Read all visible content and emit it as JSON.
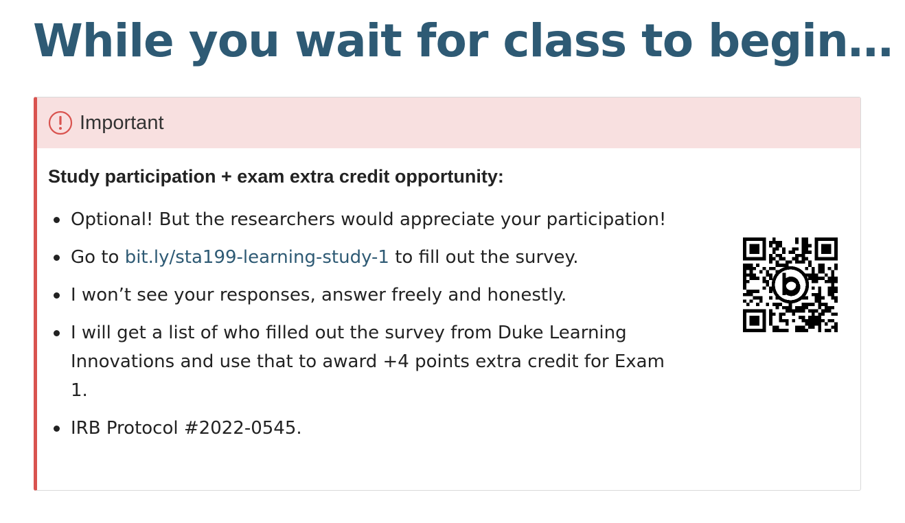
{
  "title": "While you wait for class to begin…",
  "callout": {
    "label": "Important",
    "heading": "Study participation + exam extra credit opportunity:",
    "bullets": {
      "b1": "Optional! But the researchers would appreciate your participation!",
      "b2_prefix": "Go to ",
      "b2_link": "bit.ly/sta199-learning-study-1",
      "b2_suffix": " to fill out the survey.",
      "b3": "I won’t see your responses, answer freely and honestly.",
      "b4": "I will get a list of who filled out the survey from Duke Learning Innovations and use that to award +4 points extra credit for Exam 1.",
      "b5": "IRB Protocol #2022-0545."
    }
  },
  "colors": {
    "title": "#2e5a74",
    "accent_border": "#d9534f",
    "header_bg": "#f8e0e0",
    "link": "#2e5a74"
  },
  "icons": {
    "alert": "exclamation-circle-icon",
    "qr": "qr-code-icon"
  }
}
